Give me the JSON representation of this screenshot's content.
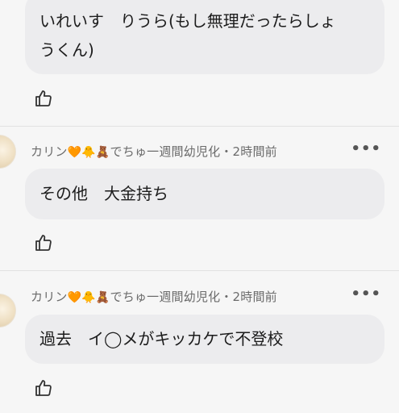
{
  "comments": [
    {
      "author": "",
      "badges": "",
      "text_lines": [
        "いれいす　りうら(もし無理だったらしょ",
        "うくん)"
      ],
      "like_icon": "thumbs-up-icon"
    },
    {
      "author": "カリン",
      "badges": "🧡🐥🧸",
      "suffix": "でちゅ一週間幼児化・2時間前",
      "more": "•••",
      "text_lines": [
        "その他　大金持ち"
      ],
      "like_icon": "thumbs-up-icon"
    },
    {
      "author": "カリン",
      "badges": "🧡🐥🧸",
      "suffix": "でちゅ一週間幼児化・2時間前",
      "more": "•••",
      "text_lines": [
        "過去　イ◯メがキッカケで不登校"
      ],
      "like_icon": "thumbs-up-icon"
    }
  ]
}
